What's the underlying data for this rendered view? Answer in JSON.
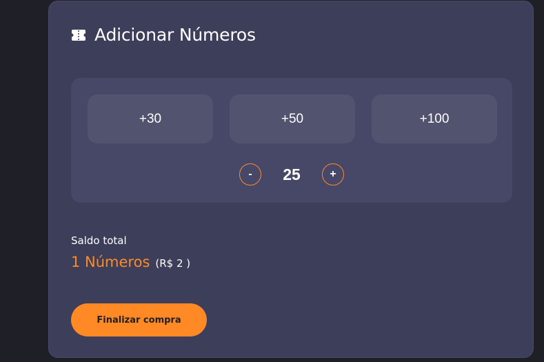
{
  "header": {
    "icon": "ticket-icon",
    "title": "Adicionar Números"
  },
  "presets": [
    {
      "label": "+30"
    },
    {
      "label": "+50"
    },
    {
      "label": "+100"
    }
  ],
  "stepper": {
    "decrement_label": "-",
    "quantity": "25",
    "increment_label": "+"
  },
  "summary": {
    "label": "Saldo total",
    "numbers": "1 Números",
    "price": "(R$ 2 )"
  },
  "actions": {
    "buy_label": "Finalizar compra"
  },
  "colors": {
    "accent": "#ff8a25",
    "card": "#3d3e5a",
    "panel": "#474867",
    "preset": "#52536f",
    "background": "#1f1f27"
  }
}
